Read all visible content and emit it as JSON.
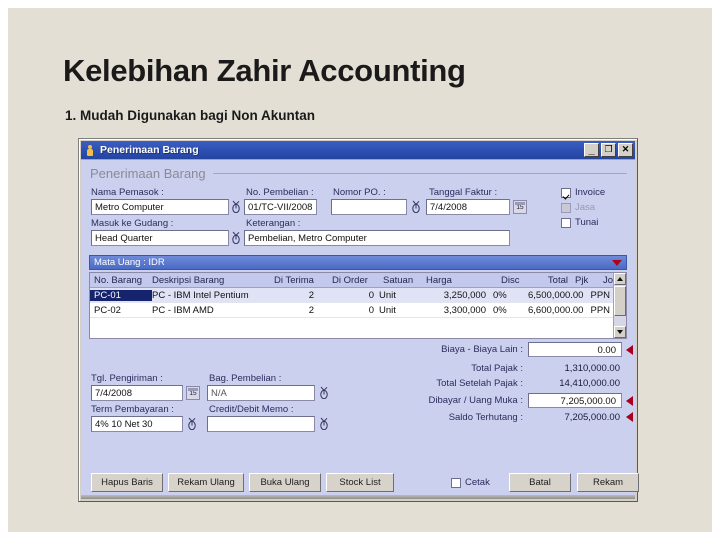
{
  "slide": {
    "title": "Kelebihan Zahir Accounting",
    "subtitle": "1. Mudah Digunakan bagi Non Akuntan",
    "background_color": "#e4dfd5"
  },
  "window": {
    "title": "Penerimaan Barang",
    "icon": "person-icon",
    "controls": {
      "minimize": "_",
      "maximize": "❐",
      "close": "✕"
    },
    "accent_color": "#2f51b4",
    "body_color": "#ccd0ef"
  },
  "form": {
    "section_heading": "Penerimaan Barang",
    "fields": {
      "nama_pemasok": {
        "label": "Nama Pemasok :",
        "value": "Metro Computer"
      },
      "no_pembelian": {
        "label": "No. Pembelian :",
        "value": "01/TC-VII/2008"
      },
      "nomor_po": {
        "label": "Nomor PO. :",
        "value": ""
      },
      "tanggal_faktur": {
        "label": "Tanggal Faktur :",
        "value": "7/4/2008",
        "calendar_day": "15"
      },
      "masuk_ke_gudang": {
        "label": "Masuk ke Gudang :",
        "value": "Head Quarter"
      },
      "keterangan": {
        "label": "Keterangan :",
        "value": "Pembelian, Metro Computer"
      },
      "tgl_pengiriman": {
        "label": "Tgl. Pengiriman :",
        "value": "7/4/2008",
        "calendar_day": "15"
      },
      "bag_pembelian": {
        "label": "Bag. Pembelian :",
        "value": "N/A"
      },
      "term_pembayaran": {
        "label": "Term Pembayaran :",
        "value": "4% 10 Net 30"
      },
      "credit_debit_memo": {
        "label": "Credit/Debit Memo :",
        "value": ""
      }
    },
    "checkboxes": [
      {
        "label": "Invoice",
        "checked": true,
        "disabled": false
      },
      {
        "label": "Jasa",
        "checked": false,
        "disabled": true
      },
      {
        "label": "Tunai",
        "checked": false,
        "disabled": false
      }
    ],
    "currency_bar": {
      "label": "Mata Uang : IDR",
      "caret": "dropdown-caret-icon"
    }
  },
  "grid": {
    "columns": [
      "No. Barang",
      "Deskripsi Barang",
      "Di Terima",
      "Di Order",
      "Satuan",
      "Harga",
      "Disc",
      "Total",
      "Pjk",
      "Job"
    ],
    "rows": [
      {
        "no_barang": "PC-01",
        "deskripsi": "PC - IBM Intel Pentium",
        "di_terima": "2",
        "di_order": "0",
        "satuan": "Unit",
        "harga": "3,250,000",
        "disc": "0%",
        "total": "6,500,000.00",
        "pjk": "PPN",
        "job": "",
        "selected": true
      },
      {
        "no_barang": "PC-02",
        "deskripsi": "PC - IBM AMD",
        "di_terima": "2",
        "di_order": "0",
        "satuan": "Unit",
        "harga": "3,300,000",
        "disc": "0%",
        "total": "6,600,000.00",
        "pjk": "PPN",
        "job": "",
        "selected": false
      }
    ]
  },
  "totals": {
    "biaya_lain": {
      "label": "Biaya - Biaya Lain :",
      "value": "0.00",
      "editable": true,
      "marker": true
    },
    "total_pajak": {
      "label": "Total Pajak :",
      "value": "1,310,000.00",
      "editable": false,
      "marker": false
    },
    "total_setelah_pajak": {
      "label": "Total Setelah Pajak :",
      "value": "14,410,000.00",
      "editable": false,
      "marker": false
    },
    "dibayar_uang_muka": {
      "label": "Dibayar / Uang Muka :",
      "value": "7,205,000.00",
      "editable": true,
      "marker": true
    },
    "saldo_terhutang": {
      "label": "Saldo Terhutang :",
      "value": "7,205,000.00",
      "editable": false,
      "marker": true
    }
  },
  "footer": {
    "buttons_left": [
      "Hapus Baris",
      "Rekam Ulang",
      "Buka Ulang",
      "Stock List"
    ],
    "cetak": {
      "label": "Cetak",
      "checked": false
    },
    "buttons_right": [
      "Batal",
      "Rekam"
    ]
  }
}
